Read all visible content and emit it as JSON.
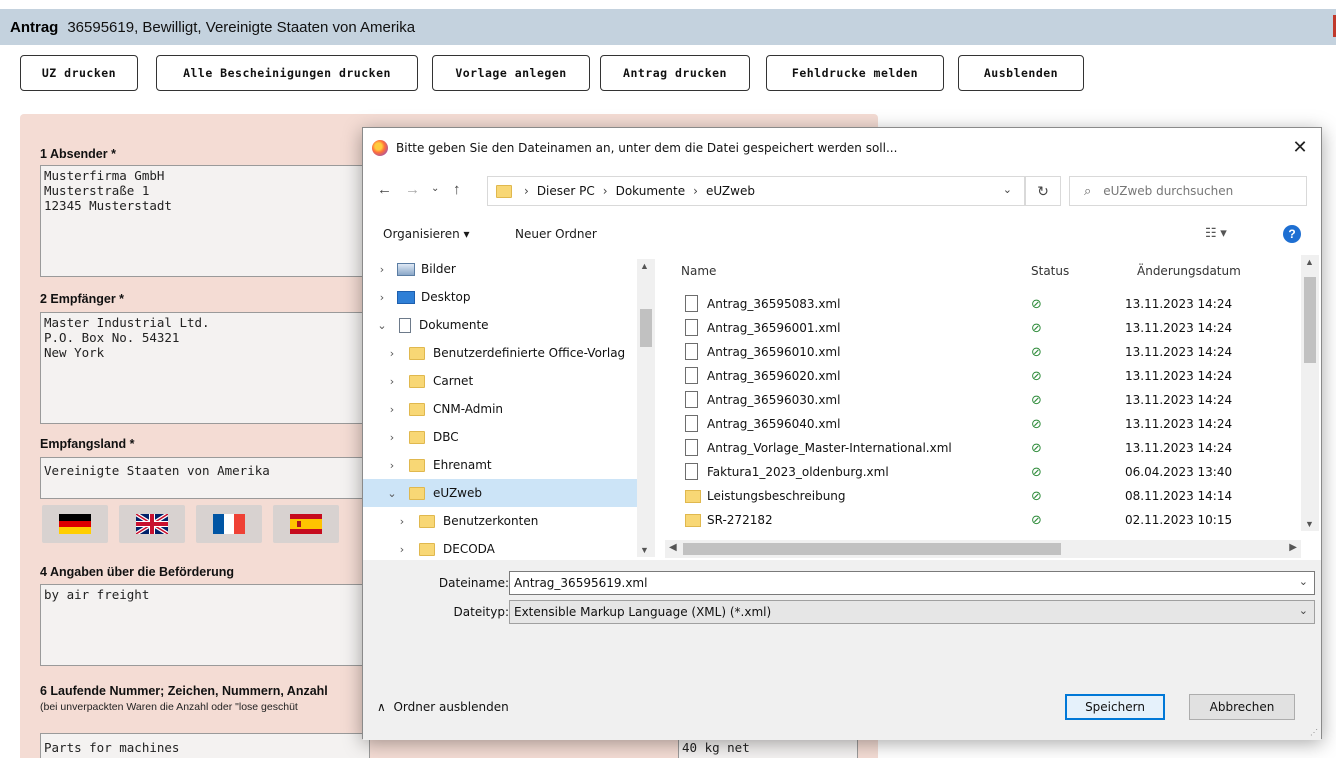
{
  "header": {
    "title": "Antrag",
    "info": "36595619, Bewilligt, Vereinigte Staaten von Amerika"
  },
  "toolbar_buttons": [
    "UZ drucken",
    "Alle Bescheinigungen drucken",
    "Vorlage anlegen",
    "Antrag drucken",
    "Fehldrucke melden",
    "Ausblenden"
  ],
  "form": {
    "sender_label": "1 Absender *",
    "sender_value": "Musterfirma GmbH\nMusterstraße 1\n12345 Musterstadt",
    "recipient_label": "2 Empfänger *",
    "recipient_value": "Master Industrial Ltd.\nP.O. Box No. 54321\nNew York",
    "country_label": "Empfangsland *",
    "country_value": "Vereinigte Staaten von Amerika",
    "transport_label": "4 Angaben über die Beförderung",
    "transport_value": "by air freight",
    "marks_label": "6 Laufende Nummer; Zeichen, Nummern, Anzahl",
    "marks_sublabel": "(bei unverpackten Waren die Anzahl oder \"lose geschüt",
    "marks_value": "Parts for machines",
    "weight_value": "40 kg net"
  },
  "dialog": {
    "title": "Bitte geben Sie den Dateinamen an, unter dem die Datei gespeichert werden soll...",
    "breadcrumbs": [
      "Dieser PC",
      "Dokumente",
      "eUZweb"
    ],
    "search_placeholder": "eUZweb durchsuchen",
    "organize_label": "Organisieren ▾",
    "new_folder_label": "Neuer Ordner",
    "tree": [
      {
        "label": "Bilder",
        "icon": "pictures-icon",
        "expanded": false
      },
      {
        "label": "Desktop",
        "icon": "desktop-icon",
        "expanded": false
      },
      {
        "label": "Dokumente",
        "icon": "documents-icon",
        "expanded": true
      },
      {
        "label": "Benutzerdefinierte Office-Vorlag",
        "icon": "folder-icon",
        "expanded": false
      },
      {
        "label": "Carnet",
        "icon": "folder-icon",
        "expanded": false
      },
      {
        "label": "CNM-Admin",
        "icon": "folder-icon",
        "expanded": false
      },
      {
        "label": "DBC",
        "icon": "folder-icon",
        "expanded": false
      },
      {
        "label": "Ehrenamt",
        "icon": "folder-icon",
        "expanded": false
      },
      {
        "label": "eUZweb",
        "icon": "folder-icon",
        "expanded": true,
        "selected": true
      },
      {
        "label": "Benutzerkonten",
        "icon": "folder-icon",
        "expanded": false
      },
      {
        "label": "DECODA",
        "icon": "folder-icon",
        "expanded": false
      }
    ],
    "columns": {
      "name": "Name",
      "status": "Status",
      "date": "Änderungsdatum"
    },
    "files": [
      {
        "name": "Antrag_36595083.xml",
        "type": "file",
        "date": "13.11.2023 14:24"
      },
      {
        "name": "Antrag_36596001.xml",
        "type": "file",
        "date": "13.11.2023 14:24"
      },
      {
        "name": "Antrag_36596010.xml",
        "type": "file",
        "date": "13.11.2023 14:24"
      },
      {
        "name": "Antrag_36596020.xml",
        "type": "file",
        "date": "13.11.2023 14:24"
      },
      {
        "name": "Antrag_36596030.xml",
        "type": "file",
        "date": "13.11.2023 14:24"
      },
      {
        "name": "Antrag_36596040.xml",
        "type": "file",
        "date": "13.11.2023 14:24"
      },
      {
        "name": "Antrag_Vorlage_Master-International.xml",
        "type": "file",
        "date": "13.11.2023 14:24"
      },
      {
        "name": "Faktura1_2023_oldenburg.xml",
        "type": "file",
        "date": "06.04.2023 13:40"
      },
      {
        "name": "Leistungsbeschreibung",
        "type": "folder",
        "date": "08.11.2023 14:14"
      },
      {
        "name": "SR-272182",
        "type": "folder",
        "date": "02.11.2023 10:15"
      }
    ],
    "filename_label": "Dateiname:",
    "filename_value": "Antrag_36595619.xml",
    "filetype_label": "Dateityp:",
    "filetype_value": "Extensible Markup Language (XML) (*.xml)",
    "hide_folders_label": "Ordner ausblenden",
    "save_label": "Speichern",
    "cancel_label": "Abbrechen"
  }
}
